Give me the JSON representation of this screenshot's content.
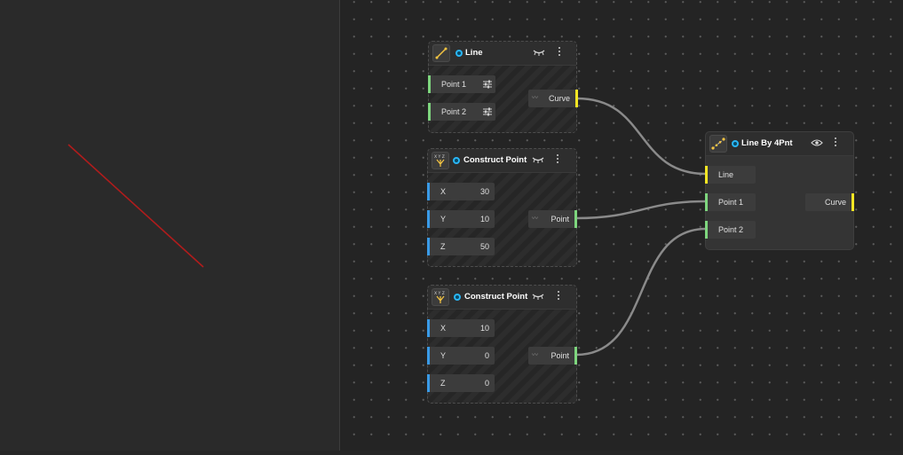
{
  "colors": {
    "accent": "#29b6f6",
    "wire": "#8a8a8a",
    "curve_port": "#f5e623",
    "point_port": "#7ed67e",
    "number_port": "#3a9be8",
    "preview_line": "#b01c1c"
  },
  "nodes": {
    "line": {
      "title": "Line",
      "icon": "line-icon",
      "inputs": [
        {
          "label": "Point 1"
        },
        {
          "label": "Point 2"
        }
      ],
      "output": {
        "label": "Curve"
      }
    },
    "construct_point_1": {
      "title": "Construct Point",
      "icon": "xyz-point-icon",
      "inputs": [
        {
          "label": "X",
          "value": "30"
        },
        {
          "label": "Y",
          "value": "10"
        },
        {
          "label": "Z",
          "value": "50"
        }
      ],
      "output": {
        "label": "Point"
      }
    },
    "construct_point_2": {
      "title": "Construct Point",
      "icon": "xyz-point-icon",
      "inputs": [
        {
          "label": "X",
          "value": "10"
        },
        {
          "label": "Y",
          "value": "0"
        },
        {
          "label": "Z",
          "value": "0"
        }
      ],
      "output": {
        "label": "Point"
      }
    },
    "line_by_4pnt": {
      "title": "Line By 4Pnt",
      "icon": "line-points-icon",
      "inputs": [
        {
          "label": "Line"
        },
        {
          "label": "Point 1"
        },
        {
          "label": "Point 2"
        }
      ],
      "output": {
        "label": "Curve"
      }
    }
  },
  "icons": {
    "hidden_preview": "eye-closed-icon",
    "visible_preview": "eye-icon",
    "menu": "more-vertical-icon"
  }
}
